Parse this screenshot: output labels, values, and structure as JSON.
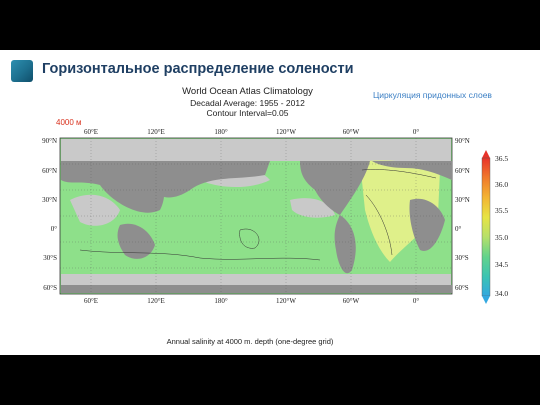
{
  "slide": {
    "title": "Горизонтальное распределение солености",
    "annotation": "Циркуляция придонных слоев",
    "depth_label": "4000 м",
    "icon": "square-gradient-icon"
  },
  "map": {
    "title_lines": [
      "World Ocean Atlas Climatology",
      "Decadal Average: 1955 - 2012",
      "Contour Interval=0.05"
    ],
    "top_longitudes": [
      "60°E",
      "120°E",
      "180°",
      "120°W",
      "60°W",
      "0°"
    ],
    "bottom_longitudes": [
      "60°E",
      "120°E",
      "180°",
      "120°W",
      "60°W",
      "0°"
    ],
    "left_latitudes": [
      "90°N",
      "60°N",
      "30°N",
      "0°",
      "30°S",
      "60°S"
    ],
    "right_latitudes": [
      "90°N",
      "60°N",
      "30°N",
      "0°",
      "30°S",
      "60°S"
    ],
    "caption": "Annual salinity at 4000 m. depth (one-degree grid)",
    "colorbar": {
      "ticks": [
        "36.5",
        "36.0",
        "35.5",
        "35.0",
        "34.5",
        "34.0"
      ],
      "colors": [
        "#e8332a",
        "#f07a2c",
        "#f3b433",
        "#e7e444",
        "#b6e06a",
        "#63d38b",
        "#3cc4b2",
        "#33a8e0"
      ]
    },
    "colors": {
      "land": "#8e8e8e",
      "no_data": "#c9c9c9",
      "ocean_low": "#8ee08a",
      "ocean_high": "#dff08a"
    }
  }
}
